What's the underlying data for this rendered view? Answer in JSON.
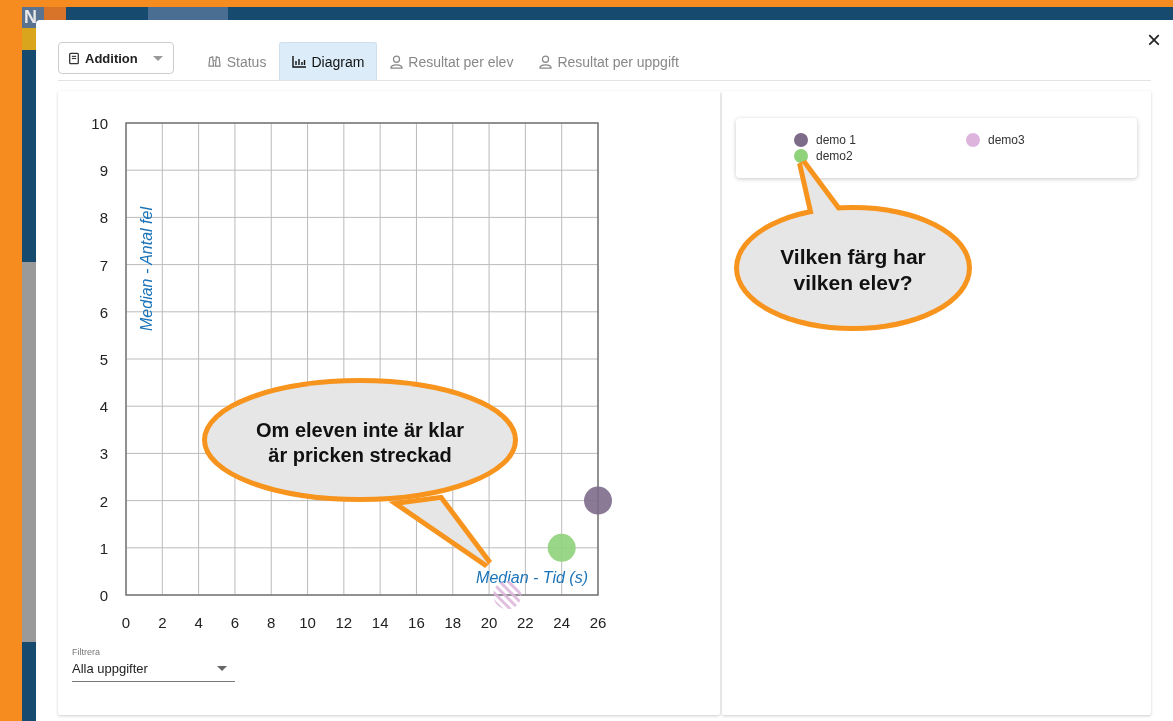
{
  "background_tiles": [
    {
      "label": "N",
      "color": "#5a7390"
    }
  ],
  "task_select": {
    "value": "Addition"
  },
  "tabs": [
    {
      "label": "Status",
      "selected": false
    },
    {
      "label": "Diagram",
      "selected": true
    },
    {
      "label": "Resultat per elev",
      "selected": false
    },
    {
      "label": "Resultat per uppgift",
      "selected": false
    }
  ],
  "close": "×",
  "chart_data": {
    "type": "scatter",
    "xlabel": "Median - Tid (s)",
    "ylabel": "Median - Antal fel",
    "xlim": [
      0,
      26
    ],
    "ylim": [
      0,
      10
    ],
    "xticks": [
      0,
      2,
      4,
      6,
      8,
      10,
      12,
      14,
      16,
      18,
      20,
      22,
      24,
      26
    ],
    "yticks": [
      0,
      1,
      2,
      3,
      4,
      5,
      6,
      7,
      8,
      9,
      10
    ],
    "x": [
      21,
      24,
      26
    ],
    "grid": true,
    "series": [
      {
        "name": "demo 1",
        "color": "#7d6b8a",
        "values": [
          null,
          null,
          2
        ]
      },
      {
        "name": "demo2",
        "color": "#8fd27a",
        "values": [
          null,
          1,
          null
        ]
      },
      {
        "name": "demo3",
        "color": "#dcb4dc",
        "values": [
          0,
          null,
          null
        ]
      }
    ]
  },
  "point_states": [
    {
      "finished": true
    },
    {
      "finished": true
    },
    {
      "finished": false
    }
  ],
  "filter": {
    "label": "Filtrera",
    "value": "Alla uppgifter"
  },
  "callouts": [
    {
      "text": "Om eleven inte är klar är pricken streckad"
    },
    {
      "text": "Vilken färg har vilken elev?"
    }
  ]
}
